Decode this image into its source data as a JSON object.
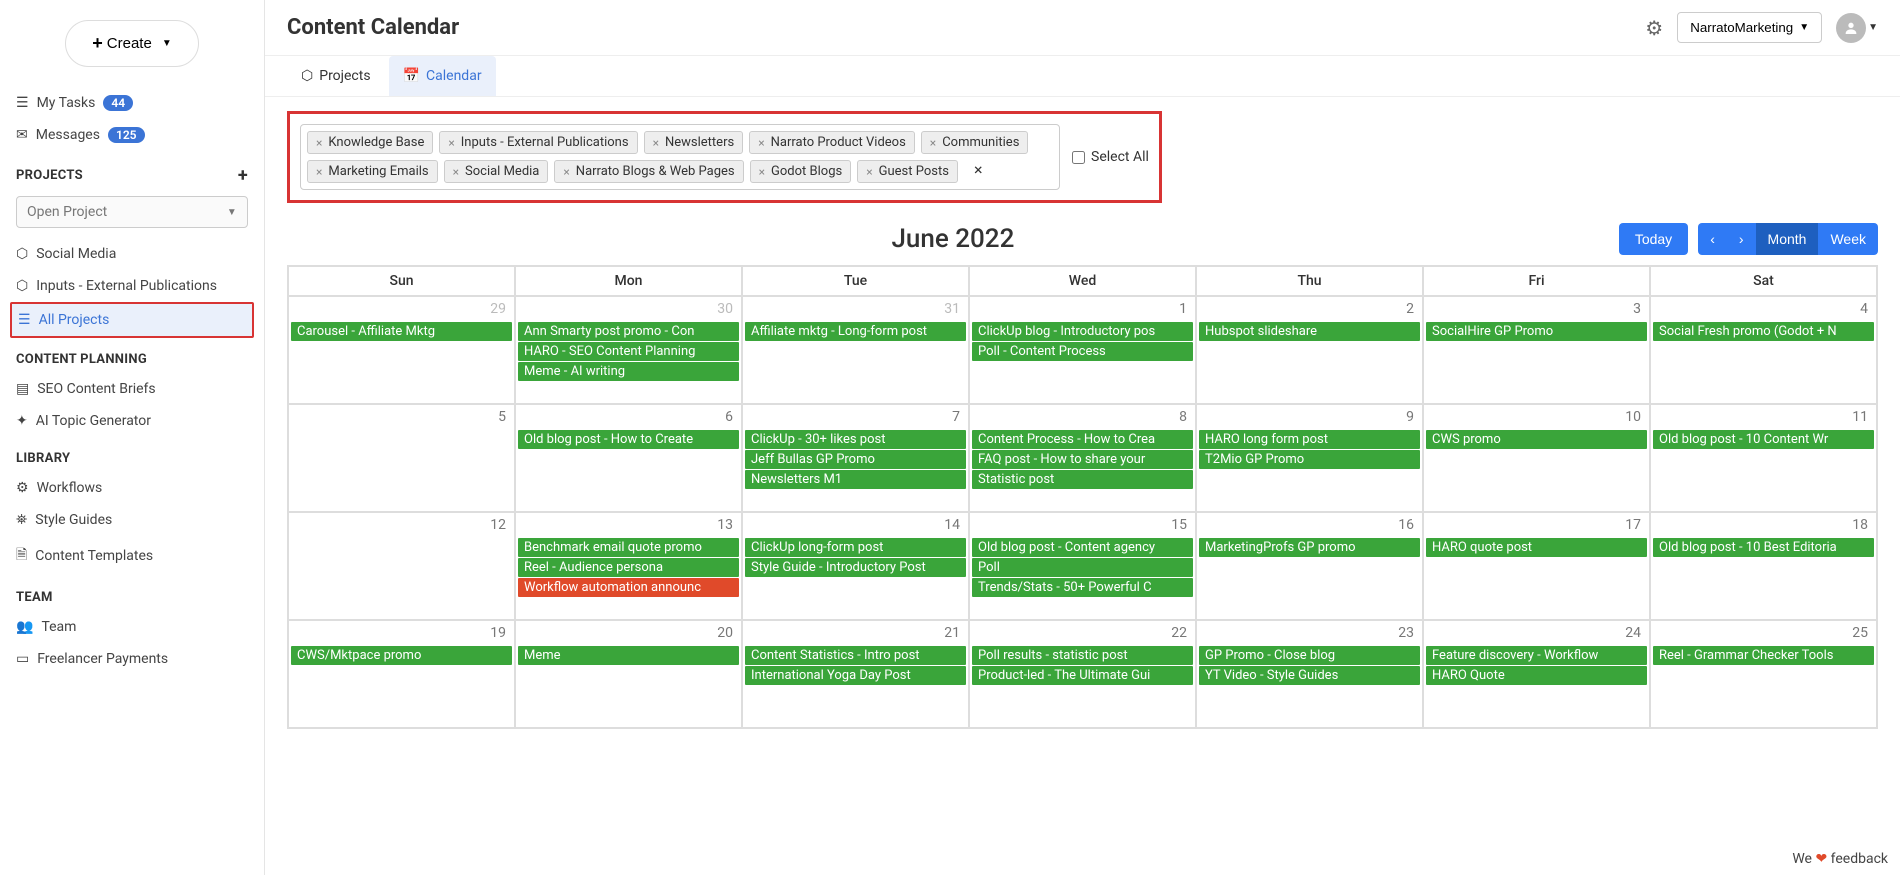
{
  "header": {
    "title": "Content Calendar",
    "workspace": "NarratoMarketing"
  },
  "sidebar": {
    "create_label": "Create",
    "my_tasks": {
      "label": "My Tasks",
      "count": "44"
    },
    "messages": {
      "label": "Messages",
      "count": "125"
    },
    "projects_header": "PROJECTS",
    "open_project_placeholder": "Open Project",
    "project_items": {
      "social_media": "Social Media",
      "inputs_ext": "Inputs - External Publications",
      "all_projects": "All Projects"
    },
    "content_planning_header": "CONTENT PLANNING",
    "seo_briefs": "SEO Content Briefs",
    "ai_topic": "AI Topic Generator",
    "library_header": "LIBRARY",
    "workflows": "Workflows",
    "style_guides": "Style Guides",
    "content_templates": "Content Templates",
    "team_header": "TEAM",
    "team": "Team",
    "freelancer_payments": "Freelancer Payments"
  },
  "tabs": {
    "projects": "Projects",
    "calendar": "Calendar"
  },
  "filters": {
    "chips": [
      "Knowledge Base",
      "Inputs - External Publications",
      "Newsletters",
      "Narrato Product Videos",
      "Communities",
      "Marketing Emails",
      "Social Media",
      "Narrato Blogs & Web Pages",
      "Godot Blogs",
      "Guest Posts"
    ],
    "select_all": "Select All"
  },
  "calendar": {
    "title": "June 2022",
    "today": "Today",
    "month": "Month",
    "week": "Week",
    "day_headers": [
      "Sun",
      "Mon",
      "Tue",
      "Wed",
      "Thu",
      "Fri",
      "Sat"
    ],
    "weeks": [
      [
        {
          "date": "29",
          "prev": true,
          "events": [
            {
              "t": "Carousel - Affiliate Mktg",
              "c": "green"
            }
          ]
        },
        {
          "date": "30",
          "prev": true,
          "events": [
            {
              "t": "Ann Smarty post promo - Con",
              "c": "green"
            },
            {
              "t": "HARO - SEO Content Planning",
              "c": "green"
            },
            {
              "t": "Meme - AI writing",
              "c": "green"
            }
          ]
        },
        {
          "date": "31",
          "prev": true,
          "events": [
            {
              "t": "Affiliate mktg - Long-form post",
              "c": "green"
            }
          ]
        },
        {
          "date": "1",
          "events": [
            {
              "t": "ClickUp blog - Introductory pos",
              "c": "green"
            },
            {
              "t": "Poll - Content Process",
              "c": "green"
            }
          ]
        },
        {
          "date": "2",
          "events": [
            {
              "t": "Hubspot slideshare",
              "c": "green"
            }
          ]
        },
        {
          "date": "3",
          "events": [
            {
              "t": "SocialHire GP Promo",
              "c": "green"
            }
          ]
        },
        {
          "date": "4",
          "events": [
            {
              "t": "Social Fresh promo (Godot + N",
              "c": "green"
            }
          ]
        }
      ],
      [
        {
          "date": "5",
          "events": []
        },
        {
          "date": "6",
          "events": [
            {
              "t": "Old blog post - How to Create",
              "c": "green"
            }
          ]
        },
        {
          "date": "7",
          "events": [
            {
              "t": "ClickUp - 30+ likes post",
              "c": "green"
            },
            {
              "t": "Jeff Bullas GP Promo",
              "c": "green"
            },
            {
              "t": "Newsletters M1",
              "c": "green"
            }
          ]
        },
        {
          "date": "8",
          "events": [
            {
              "t": "Content Process - How to Crea",
              "c": "green"
            },
            {
              "t": "FAQ post - How to share your",
              "c": "green"
            },
            {
              "t": "Statistic post",
              "c": "green"
            }
          ]
        },
        {
          "date": "9",
          "events": [
            {
              "t": "HARO long form post",
              "c": "green"
            },
            {
              "t": "T2Mio GP Promo",
              "c": "green"
            }
          ]
        },
        {
          "date": "10",
          "events": [
            {
              "t": "CWS promo",
              "c": "green"
            }
          ]
        },
        {
          "date": "11",
          "events": [
            {
              "t": "Old blog post - 10 Content Wr",
              "c": "green"
            }
          ]
        }
      ],
      [
        {
          "date": "12",
          "events": []
        },
        {
          "date": "13",
          "events": [
            {
              "t": "Benchmark email quote promo",
              "c": "green"
            },
            {
              "t": "Reel - Audience persona",
              "c": "green"
            },
            {
              "t": "Workflow automation announc",
              "c": "red"
            }
          ]
        },
        {
          "date": "14",
          "events": [
            {
              "t": "ClickUp long-form post",
              "c": "green"
            },
            {
              "t": "Style Guide - Introductory Post",
              "c": "green"
            }
          ]
        },
        {
          "date": "15",
          "events": [
            {
              "t": "Old blog post - Content agency",
              "c": "green"
            },
            {
              "t": "Poll",
              "c": "green"
            },
            {
              "t": "Trends/Stats - 50+ Powerful C",
              "c": "green"
            }
          ]
        },
        {
          "date": "16",
          "events": [
            {
              "t": "MarketingProfs GP promo",
              "c": "green"
            }
          ]
        },
        {
          "date": "17",
          "events": [
            {
              "t": "HARO quote post",
              "c": "green"
            }
          ]
        },
        {
          "date": "18",
          "events": [
            {
              "t": "Old blog post - 10 Best Editoria",
              "c": "green"
            }
          ]
        }
      ],
      [
        {
          "date": "19",
          "events": [
            {
              "t": "CWS/Mktpace promo",
              "c": "green"
            }
          ]
        },
        {
          "date": "20",
          "events": [
            {
              "t": "Meme",
              "c": "green"
            }
          ]
        },
        {
          "date": "21",
          "events": [
            {
              "t": "Content Statistics - Intro post",
              "c": "green"
            },
            {
              "t": "International Yoga Day Post",
              "c": "green"
            }
          ]
        },
        {
          "date": "22",
          "events": [
            {
              "t": "Poll results - statistic post",
              "c": "green"
            },
            {
              "t": "Product-led - The Ultimate Gui",
              "c": "green"
            }
          ]
        },
        {
          "date": "23",
          "events": [
            {
              "t": "GP Promo - Close blog",
              "c": "green"
            },
            {
              "t": "YT Video - Style Guides",
              "c": "green"
            }
          ]
        },
        {
          "date": "24",
          "events": [
            {
              "t": "Feature discovery - Workflow",
              "c": "green"
            },
            {
              "t": "HARO Quote",
              "c": "green"
            }
          ]
        },
        {
          "date": "25",
          "events": [
            {
              "t": "Reel - Grammar Checker Tools",
              "c": "green"
            }
          ]
        }
      ]
    ]
  },
  "feedback": {
    "pre": "We ",
    "post": " feedback"
  }
}
